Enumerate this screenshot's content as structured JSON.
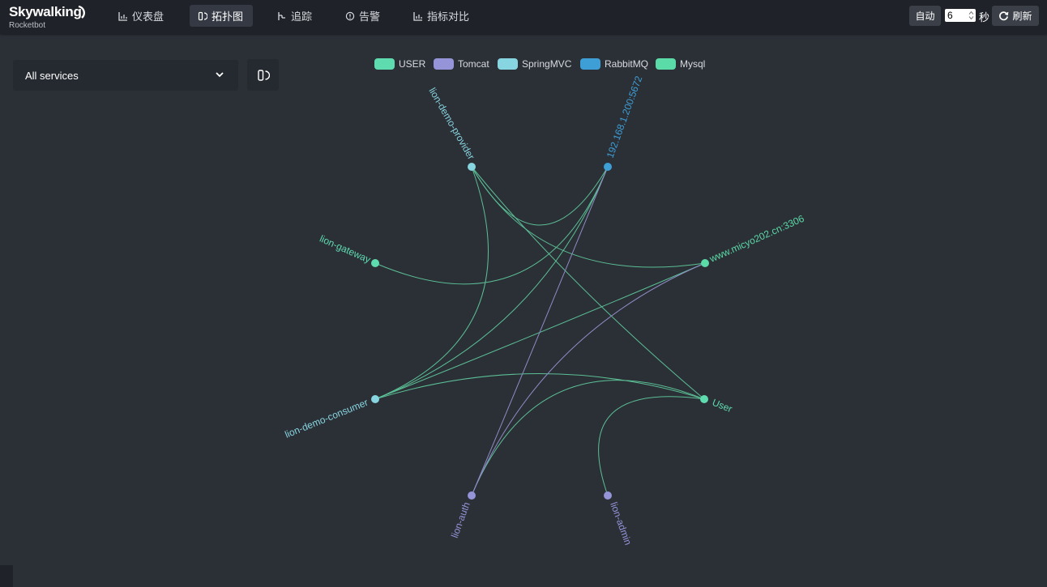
{
  "app": {
    "logo_text": "Skywalking",
    "logo_sub": "Rocketbot"
  },
  "nav": [
    {
      "label": "仪表盘",
      "icon": "chart-icon",
      "active": false
    },
    {
      "label": "拓扑图",
      "icon": "topology-icon",
      "active": true
    },
    {
      "label": "追踪",
      "icon": "trace-icon",
      "active": false
    },
    {
      "label": "告警",
      "icon": "alarm-icon",
      "active": false
    },
    {
      "label": "指标对比",
      "icon": "compare-icon",
      "active": false
    }
  ],
  "controls": {
    "auto_label": "自动",
    "interval_value": "6",
    "seconds_label": "秒",
    "refresh_label": "刷新"
  },
  "service_selector": {
    "value": "All services"
  },
  "legend": [
    {
      "label": "USER",
      "color": "#5edcb0"
    },
    {
      "label": "Tomcat",
      "color": "#9594d8"
    },
    {
      "label": "SpringMVC",
      "color": "#87d5e0"
    },
    {
      "label": "RabbitMQ",
      "color": "#3e9fd6"
    },
    {
      "label": "Mysql",
      "color": "#5bdba7"
    }
  ],
  "topology": {
    "nodes": [
      {
        "id": "provider",
        "label": "lion-demo-provider",
        "type": "SpringMVC"
      },
      {
        "id": "rabbit",
        "label": "192.168.1.200:5672",
        "type": "RabbitMQ"
      },
      {
        "id": "gateway",
        "label": "lion-gateway",
        "type": "USER"
      },
      {
        "id": "mysql",
        "label": "www.micyo202.cn:3306",
        "type": "Mysql"
      },
      {
        "id": "consumer",
        "label": "lion-demo-consumer",
        "type": "SpringMVC"
      },
      {
        "id": "user",
        "label": "User",
        "type": "USER"
      },
      {
        "id": "auth",
        "label": "lion-auth",
        "type": "Tomcat"
      },
      {
        "id": "admin",
        "label": "lion-admin",
        "type": "Tomcat"
      }
    ]
  }
}
